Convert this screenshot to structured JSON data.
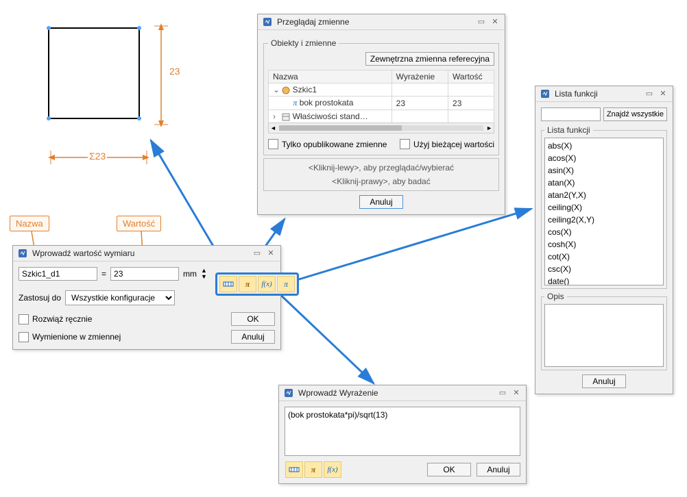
{
  "sketch": {
    "dim_vert": "23",
    "dim_horiz": "Σ23"
  },
  "annotations": {
    "nazwa": "Nazwa",
    "wartosc": "Wartość"
  },
  "dim_dialog": {
    "title": "Wprowadź wartość wymiaru",
    "name_value": "Szkic1_d1",
    "eq": "=",
    "value_value": "23",
    "unit": "mm",
    "apply_label": "Zastosuj do",
    "apply_sel": "Wszystkie konfiguracje",
    "solve_manual": "Rozwiąż ręcznie",
    "listed_in_vars": "Wymienione w zmiennej",
    "ok": "OK",
    "cancel": "Anuluj"
  },
  "browse_vars": {
    "title": "Przeglądaj zmienne",
    "fieldset": "Obiekty i zmienne",
    "ext_ref_btn": "Zewnętrzna zmienna referecyjna",
    "col_name": "Nazwa",
    "col_expr": "Wyrażenie",
    "col_val": "Wartość",
    "rows": [
      {
        "name": "Szkic1",
        "expr": "",
        "val": "",
        "indent": 0,
        "expand": "v",
        "icon": "sketch"
      },
      {
        "name": "bok prostokata",
        "expr": "23",
        "val": "23",
        "indent": 1,
        "icon": "pi"
      },
      {
        "name": "Właściwości stand…",
        "expr": "",
        "val": "",
        "indent": 0,
        "expand": ">",
        "icon": "props"
      }
    ],
    "only_pub": "Tylko opublikowane zmienne",
    "use_curr": "Użyj bieżącej wartości",
    "hint_left": "<Kliknij-lewy>, aby przeglądać/wybierać",
    "hint_right": "<Kliknij-prawy>, aby badać",
    "cancel": "Anuluj"
  },
  "expr_dialog": {
    "title": "Wprowadź Wyrażenie",
    "value": "(bok prostokata*pi)/sqrt(13)",
    "ok": "OK",
    "cancel": "Anuluj"
  },
  "func_list": {
    "title": "Lista funkcji",
    "find_all": "Znajdź wszystkie",
    "fieldset": "Lista funkcji",
    "items": [
      "abs(X)",
      "acos(X)",
      "asin(X)",
      "atan(X)",
      "atan2(Y,X)",
      "ceiling(X)",
      "ceiling2(X,Y)",
      "cos(X)",
      "cosh(X)",
      "cot(X)",
      "csc(X)",
      "date()"
    ],
    "desc_label": "Opis",
    "cancel": "Anuluj"
  }
}
